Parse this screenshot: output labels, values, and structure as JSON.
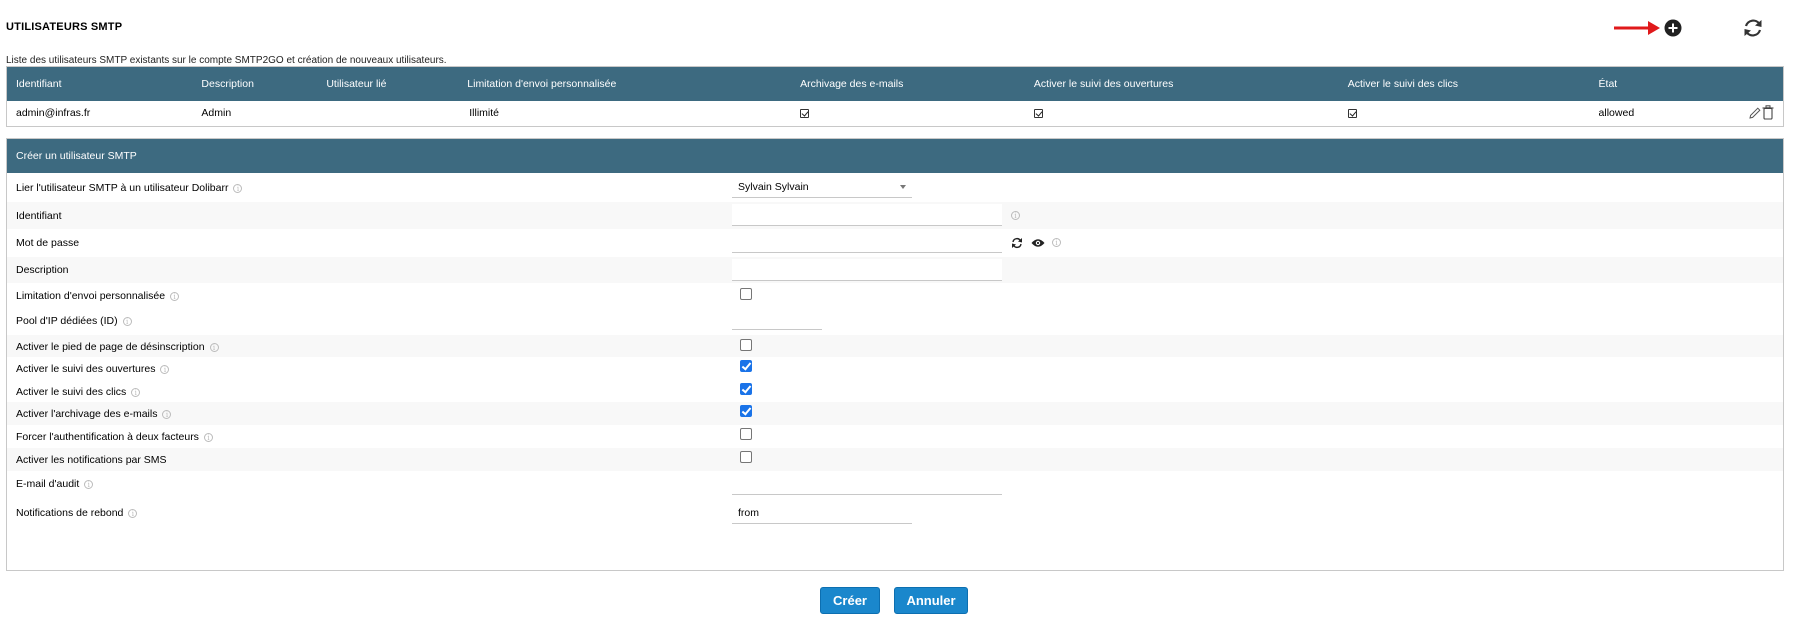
{
  "header": {
    "title": "UTILISATEURS SMTP",
    "subtitle": "Liste des utilisateurs SMTP existants sur le compte SMTP2GO et création de nouveaux utilisateurs.",
    "arrow_color": "#e0191b"
  },
  "users_table": {
    "columns": [
      "Identifiant",
      "Description",
      "Utilisateur lié",
      "Limitation d'envoi personnalisée",
      "Archivage des e-mails",
      "Activer le suivi des ouvertures",
      "Activer le suivi des clics",
      "État"
    ],
    "rows": [
      {
        "identifiant": "admin@infras.fr",
        "description": "Admin",
        "linked_user": "",
        "limit": "Illimité",
        "archiving": true,
        "open_tracking": true,
        "click_tracking": true,
        "state": "allowed"
      }
    ]
  },
  "form": {
    "title": "Créer un utilisateur SMTP",
    "link_user_label": "Lier l'utilisateur SMTP à un utilisateur Dolibarr",
    "link_user_value": "Sylvain Sylvain",
    "identifiant_label": "Identifiant",
    "identifiant_value": "",
    "password_label": "Mot de passe",
    "password_value": "",
    "description_label": "Description",
    "description_value": "",
    "custom_limit_label": "Limitation d'envoi personnalisée",
    "custom_limit_checked": false,
    "ip_pool_label": "Pool d'IP dédiées (ID)",
    "ip_pool_value": "",
    "unsub_footer_label": "Activer le pied de page de désinscription",
    "unsub_footer_checked": false,
    "open_tracking_label": "Activer le suivi des ouvertures",
    "open_tracking_checked": true,
    "click_tracking_label": "Activer le suivi des clics",
    "click_tracking_checked": true,
    "archiving_label": "Activer l'archivage des e-mails",
    "archiving_checked": true,
    "two_factor_label": "Forcer l'authentification à deux facteurs",
    "two_factor_checked": false,
    "sms_label": "Activer les notifications par SMS",
    "sms_checked": false,
    "audit_email_label": "E-mail d'audit",
    "audit_email_value": "",
    "bounce_label": "Notifications de rebond",
    "bounce_value": "from"
  },
  "buttons": {
    "create": "Créer",
    "cancel": "Annuler"
  },
  "colors": {
    "header_bg": "#3d6a80",
    "button_bg": "#1a87cc",
    "checkbox_checked": "#1a73e8"
  }
}
